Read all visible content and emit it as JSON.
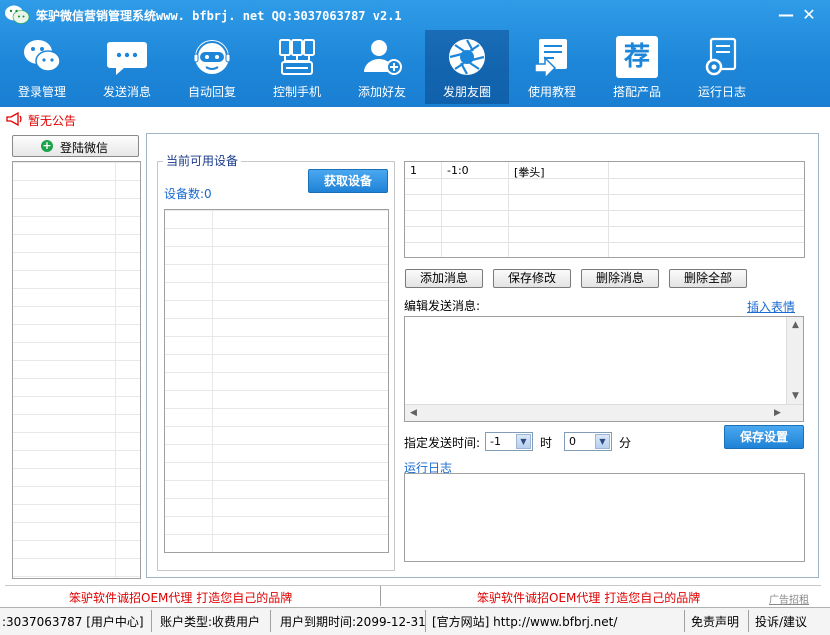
{
  "window": {
    "title": "笨驴微信营销管理系统www. bfbrj. net QQ:3037063787 v2.1",
    "minimize_label": "—",
    "close_label": "✕"
  },
  "nav": [
    {
      "label": "登录管理",
      "icon": "wechat-icon"
    },
    {
      "label": "发送消息",
      "icon": "chat-bubble-icon"
    },
    {
      "label": "自动回复",
      "icon": "robot-icon"
    },
    {
      "label": "控制手机",
      "icon": "phones-icon"
    },
    {
      "label": "添加好友",
      "icon": "add-user-icon"
    },
    {
      "label": "发朋友圈",
      "icon": "camera-aperture-icon",
      "active": true
    },
    {
      "label": "使用教程",
      "icon": "tutorial-icon"
    },
    {
      "label": "搭配产品",
      "icon": "recommend-icon"
    },
    {
      "label": "运行日志",
      "icon": "log-gear-icon"
    }
  ],
  "recommend_glyph": "荐",
  "notice": "暂无公告",
  "left": {
    "login_button": "登陆微信"
  },
  "devices": {
    "group_title": "当前可用设备",
    "count_label": "设备数:0",
    "fetch_button": "获取设备"
  },
  "message_table": {
    "rows": [
      {
        "col1": "1",
        "col2": "-1:0",
        "col3": "[拳头]"
      }
    ]
  },
  "message_buttons": {
    "add": "添加消息",
    "save": "保存修改",
    "delete": "删除消息",
    "delete_all": "删除全部"
  },
  "editor": {
    "label": "编辑发送消息:",
    "emoji_link": "插入表情"
  },
  "schedule": {
    "label": "指定发送时间:",
    "hour_value": "-1",
    "hour_unit": "时",
    "minute_value": "0",
    "minute_unit": "分",
    "save_button": "保存设置"
  },
  "log": {
    "title": "运行日志"
  },
  "ads": {
    "left": "笨驴软件诚招OEM代理 打造您自己的品牌",
    "right": "笨驴软件诚招OEM代理 打造您自己的品牌",
    "small": "广告招租"
  },
  "status": {
    "user": ":3037063787 [用户中心]",
    "account_type": "账户类型:收费用户",
    "expiry": "用户到期时间:2099-12-31",
    "site": "[官方网站] http://www.bfbrj.net/",
    "disclaimer": "免责声明",
    "feedback": "投诉/建议"
  },
  "colors": {
    "header_blue": "#1e86d8",
    "accent_red": "#e00000",
    "link_blue": "#1a6ad0"
  }
}
